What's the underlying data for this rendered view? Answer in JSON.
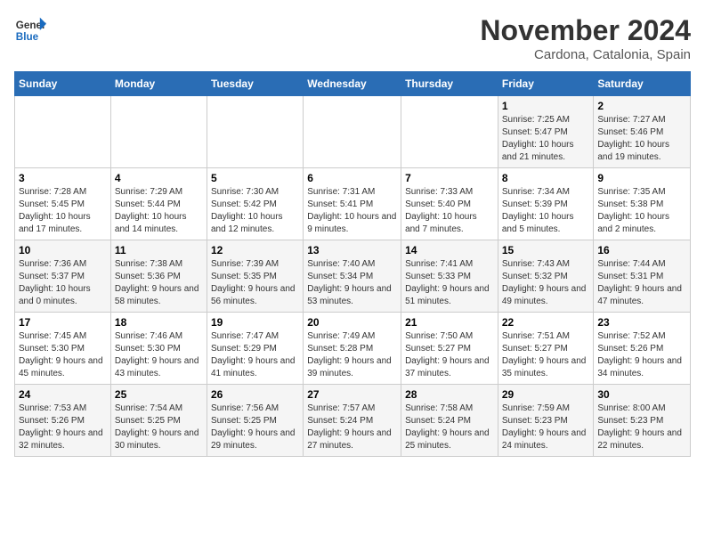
{
  "logo": {
    "line1": "General",
    "line2": "Blue"
  },
  "title": "November 2024",
  "location": "Cardona, Catalonia, Spain",
  "weekdays": [
    "Sunday",
    "Monday",
    "Tuesday",
    "Wednesday",
    "Thursday",
    "Friday",
    "Saturday"
  ],
  "weeks": [
    [
      {
        "day": "",
        "info": ""
      },
      {
        "day": "",
        "info": ""
      },
      {
        "day": "",
        "info": ""
      },
      {
        "day": "",
        "info": ""
      },
      {
        "day": "",
        "info": ""
      },
      {
        "day": "1",
        "info": "Sunrise: 7:25 AM\nSunset: 5:47 PM\nDaylight: 10 hours and 21 minutes."
      },
      {
        "day": "2",
        "info": "Sunrise: 7:27 AM\nSunset: 5:46 PM\nDaylight: 10 hours and 19 minutes."
      }
    ],
    [
      {
        "day": "3",
        "info": "Sunrise: 7:28 AM\nSunset: 5:45 PM\nDaylight: 10 hours and 17 minutes."
      },
      {
        "day": "4",
        "info": "Sunrise: 7:29 AM\nSunset: 5:44 PM\nDaylight: 10 hours and 14 minutes."
      },
      {
        "day": "5",
        "info": "Sunrise: 7:30 AM\nSunset: 5:42 PM\nDaylight: 10 hours and 12 minutes."
      },
      {
        "day": "6",
        "info": "Sunrise: 7:31 AM\nSunset: 5:41 PM\nDaylight: 10 hours and 9 minutes."
      },
      {
        "day": "7",
        "info": "Sunrise: 7:33 AM\nSunset: 5:40 PM\nDaylight: 10 hours and 7 minutes."
      },
      {
        "day": "8",
        "info": "Sunrise: 7:34 AM\nSunset: 5:39 PM\nDaylight: 10 hours and 5 minutes."
      },
      {
        "day": "9",
        "info": "Sunrise: 7:35 AM\nSunset: 5:38 PM\nDaylight: 10 hours and 2 minutes."
      }
    ],
    [
      {
        "day": "10",
        "info": "Sunrise: 7:36 AM\nSunset: 5:37 PM\nDaylight: 10 hours and 0 minutes."
      },
      {
        "day": "11",
        "info": "Sunrise: 7:38 AM\nSunset: 5:36 PM\nDaylight: 9 hours and 58 minutes."
      },
      {
        "day": "12",
        "info": "Sunrise: 7:39 AM\nSunset: 5:35 PM\nDaylight: 9 hours and 56 minutes."
      },
      {
        "day": "13",
        "info": "Sunrise: 7:40 AM\nSunset: 5:34 PM\nDaylight: 9 hours and 53 minutes."
      },
      {
        "day": "14",
        "info": "Sunrise: 7:41 AM\nSunset: 5:33 PM\nDaylight: 9 hours and 51 minutes."
      },
      {
        "day": "15",
        "info": "Sunrise: 7:43 AM\nSunset: 5:32 PM\nDaylight: 9 hours and 49 minutes."
      },
      {
        "day": "16",
        "info": "Sunrise: 7:44 AM\nSunset: 5:31 PM\nDaylight: 9 hours and 47 minutes."
      }
    ],
    [
      {
        "day": "17",
        "info": "Sunrise: 7:45 AM\nSunset: 5:30 PM\nDaylight: 9 hours and 45 minutes."
      },
      {
        "day": "18",
        "info": "Sunrise: 7:46 AM\nSunset: 5:30 PM\nDaylight: 9 hours and 43 minutes."
      },
      {
        "day": "19",
        "info": "Sunrise: 7:47 AM\nSunset: 5:29 PM\nDaylight: 9 hours and 41 minutes."
      },
      {
        "day": "20",
        "info": "Sunrise: 7:49 AM\nSunset: 5:28 PM\nDaylight: 9 hours and 39 minutes."
      },
      {
        "day": "21",
        "info": "Sunrise: 7:50 AM\nSunset: 5:27 PM\nDaylight: 9 hours and 37 minutes."
      },
      {
        "day": "22",
        "info": "Sunrise: 7:51 AM\nSunset: 5:27 PM\nDaylight: 9 hours and 35 minutes."
      },
      {
        "day": "23",
        "info": "Sunrise: 7:52 AM\nSunset: 5:26 PM\nDaylight: 9 hours and 34 minutes."
      }
    ],
    [
      {
        "day": "24",
        "info": "Sunrise: 7:53 AM\nSunset: 5:26 PM\nDaylight: 9 hours and 32 minutes."
      },
      {
        "day": "25",
        "info": "Sunrise: 7:54 AM\nSunset: 5:25 PM\nDaylight: 9 hours and 30 minutes."
      },
      {
        "day": "26",
        "info": "Sunrise: 7:56 AM\nSunset: 5:25 PM\nDaylight: 9 hours and 29 minutes."
      },
      {
        "day": "27",
        "info": "Sunrise: 7:57 AM\nSunset: 5:24 PM\nDaylight: 9 hours and 27 minutes."
      },
      {
        "day": "28",
        "info": "Sunrise: 7:58 AM\nSunset: 5:24 PM\nDaylight: 9 hours and 25 minutes."
      },
      {
        "day": "29",
        "info": "Sunrise: 7:59 AM\nSunset: 5:23 PM\nDaylight: 9 hours and 24 minutes."
      },
      {
        "day": "30",
        "info": "Sunrise: 8:00 AM\nSunset: 5:23 PM\nDaylight: 9 hours and 22 minutes."
      }
    ]
  ]
}
